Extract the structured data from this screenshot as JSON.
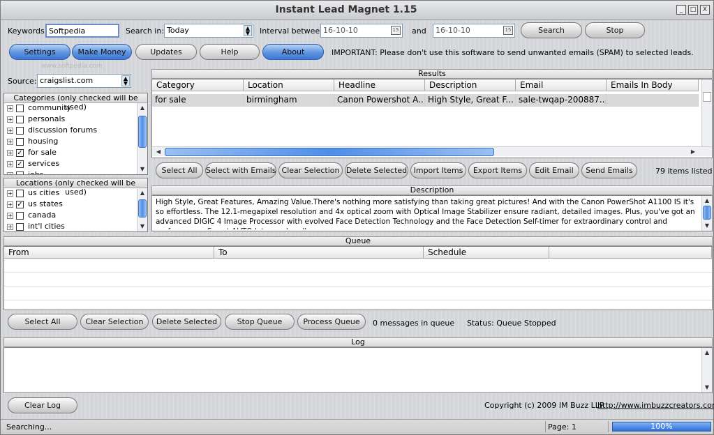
{
  "window": {
    "title": "Instant Lead Magnet 1.15",
    "controls": [
      "_",
      "□",
      "X"
    ]
  },
  "search": {
    "keywords_label": "Keywords:",
    "keywords_value": "Softpedia",
    "search_in_label": "Search in:",
    "search_in_value": "Today",
    "interval_label": "Interval between",
    "date_from": "16-10-10",
    "and_label": "and",
    "date_to": "16-10-10",
    "search_button": "Search",
    "stop_button": "Stop"
  },
  "toolbar": {
    "settings": "Settings",
    "make_money": "Make Money",
    "updates": "Updates",
    "help": "Help",
    "about": "About",
    "notice": "IMPORTANT: Please don't use this software to send unwanted emails (SPAM) to selected leads.",
    "watermark": "www.softpedia.com"
  },
  "source": {
    "label": "Source:",
    "value": "craigslist.com"
  },
  "categories": {
    "title": "Categories (only checked will be used)",
    "items": [
      {
        "label": "community",
        "checked": false
      },
      {
        "label": "personals",
        "checked": false
      },
      {
        "label": "discussion forums",
        "checked": false
      },
      {
        "label": "housing",
        "checked": false
      },
      {
        "label": "for sale",
        "checked": true
      },
      {
        "label": "services",
        "checked": true
      },
      {
        "label": "jobs",
        "checked": false
      }
    ]
  },
  "locations": {
    "title": "Locations (only checked will be used)",
    "items": [
      {
        "label": "us cities",
        "checked": false
      },
      {
        "label": "us states",
        "checked": true
      },
      {
        "label": "canada",
        "checked": false
      },
      {
        "label": "int'l cities",
        "checked": false
      }
    ]
  },
  "results": {
    "title": "Results",
    "columns": [
      "Category",
      "Location",
      "Headline",
      "Description",
      "Email",
      "Emails In Body"
    ],
    "rows": [
      [
        "for sale",
        "birmingham",
        "Canon Powershot A...",
        "High Style, Great F...",
        "sale-twqap-200887...",
        ""
      ]
    ],
    "buttons": {
      "select_all": "Select All",
      "select_emails": "Select with Emails",
      "clear": "Clear Selection",
      "delete": "Delete Selected",
      "import": "Import Items",
      "export": "Export Items",
      "edit": "Edit Email",
      "send": "Send Emails"
    },
    "count": "79 items listed"
  },
  "description": {
    "title": "Description",
    "text": "High Style, Great Features, Amazing Value.There's nothing more satisfying than taking great pictures! And with the Canon PowerShot A1100 IS it's so effortless. The 12.1-megapixel resolution and 4x optical zoom with Optical Image Stabilizer ensure radiant, detailed images. Plus, you've got an advanced DIGIC 4 Image Processor with evolved Face Detection Technology and the Face Detection Self-timer for extraordinary control and performance. Smart AUTO lets you handle"
  },
  "queue": {
    "title": "Queue",
    "columns": [
      "From",
      "To",
      "Schedule"
    ],
    "buttons": {
      "select_all": "Select All",
      "clear": "Clear Selection",
      "delete": "Delete Selected",
      "stop": "Stop Queue",
      "process": "Process Queue"
    },
    "messages": "0 messages in queue",
    "status": "Status: Queue Stopped"
  },
  "log": {
    "title": "Log",
    "clear_button": "Clear Log",
    "copyright": "Copyright (c) 2009 IM Buzz LLP",
    "url": "http://www.imbuzzcreators.com"
  },
  "statusbar": {
    "state": "Searching...",
    "page": "Page: 1",
    "progress_label": "100%",
    "progress_value": 1.0
  }
}
